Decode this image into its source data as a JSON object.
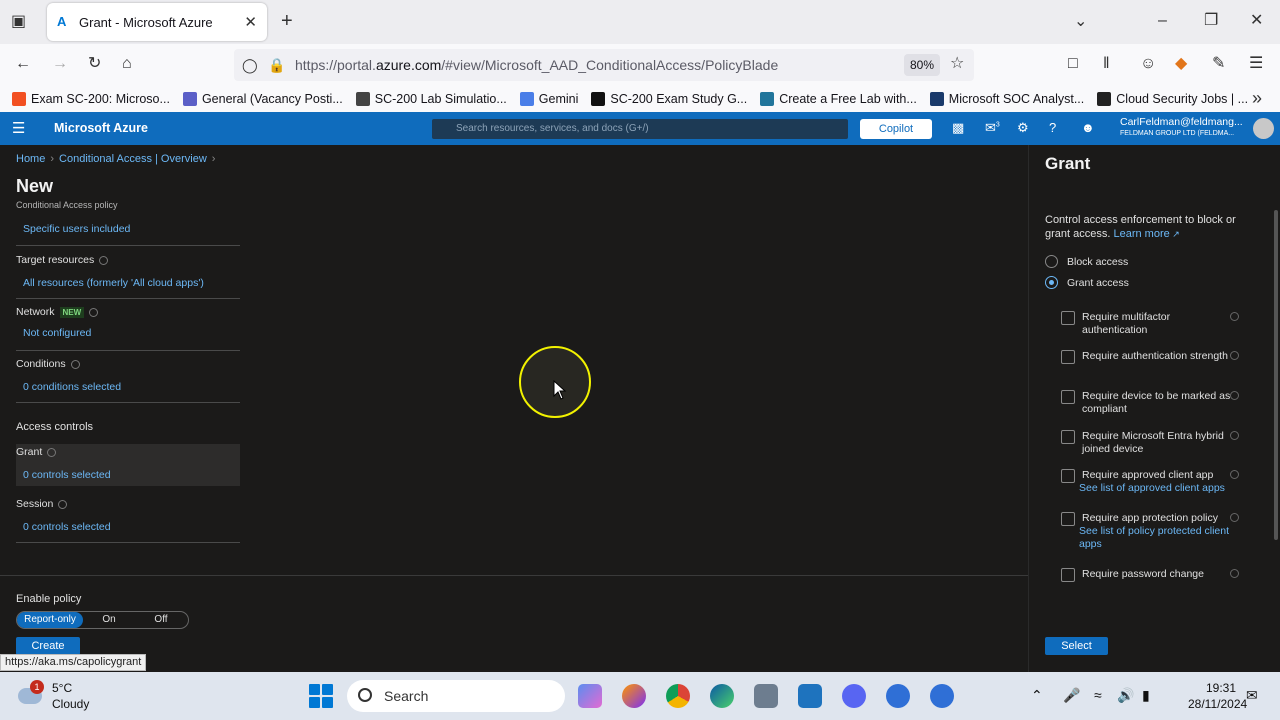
{
  "browser": {
    "tab_title": "Grant - Microsoft Azure",
    "url_prefix": "https://portal.",
    "url_domain": "azure.com",
    "url_path": "/#view/Microsoft_AAD_ConditionalAccess/PolicyBlade",
    "zoom": "80%",
    "bookmarks": [
      {
        "label": "Exam SC-200: Microso...",
        "color": "#f25022"
      },
      {
        "label": "General (Vacancy Posti...",
        "color": "#5b5fc7"
      },
      {
        "label": "SC-200 Lab Simulatio...",
        "color": "#444444"
      },
      {
        "label": "Gemini",
        "color": "#4a7ee8"
      },
      {
        "label": "SC-200 Exam Study G...",
        "color": "#111111"
      },
      {
        "label": "Create a Free Lab with...",
        "color": "#21759b"
      },
      {
        "label": "Microsoft SOC Analyst...",
        "color": "#1a3a6b"
      },
      {
        "label": "Cloud Security Jobs | ...",
        "color": "#222222"
      }
    ],
    "status_url": "https://aka.ms/capolicygrant"
  },
  "azure": {
    "brand": "Microsoft Azure",
    "search_placeholder": "Search resources, services, and docs (G+/)",
    "copilot": "Copilot",
    "notification_count": "3",
    "user_name": "CarlFeldman@feldmang...",
    "user_org": "FELDMAN GROUP LTD (FELDMA..."
  },
  "blade": {
    "breadcrumb": [
      "Home",
      "Conditional Access | Overview"
    ],
    "title": "New",
    "subtitle": "Conditional Access policy",
    "users_value": "Specific users included",
    "target_label": "Target resources",
    "target_value": "All resources (formerly 'All cloud apps')",
    "network_label": "Network",
    "network_badge": "NEW",
    "network_value": "Not configured",
    "conditions_label": "Conditions",
    "conditions_value": "0 conditions selected",
    "access_controls": "Access controls",
    "grant_label": "Grant",
    "grant_value": "0 controls selected",
    "session_label": "Session",
    "session_value": "0 controls selected",
    "enable_policy": "Enable policy",
    "toggle": [
      "Report-only",
      "On",
      "Off"
    ],
    "toggle_selected": "Report-only",
    "create": "Create"
  },
  "grant_panel": {
    "title": "Grant",
    "desc": "Control access enforcement to block or grant access.",
    "learn_more": "Learn more",
    "block": "Block access",
    "grant": "Grant access",
    "selected": "Grant access",
    "options": [
      {
        "label": "Require multifactor authentication",
        "link": ""
      },
      {
        "label": "Require authentication strength",
        "link": ""
      },
      {
        "label": "Require device to be marked as compliant",
        "link": ""
      },
      {
        "label": "Require Microsoft Entra hybrid joined device",
        "link": ""
      },
      {
        "label": "Require approved client app",
        "link": "See list of approved client apps"
      },
      {
        "label": "Require app protection policy",
        "link": "See list of policy protected client apps"
      },
      {
        "label": "Require password change",
        "link": ""
      }
    ],
    "select": "Select"
  },
  "taskbar": {
    "weather_temp": "5°C",
    "weather_desc": "Cloudy",
    "weather_badge": "1",
    "search": "Search",
    "time": "19:31",
    "date": "28/11/2024"
  }
}
